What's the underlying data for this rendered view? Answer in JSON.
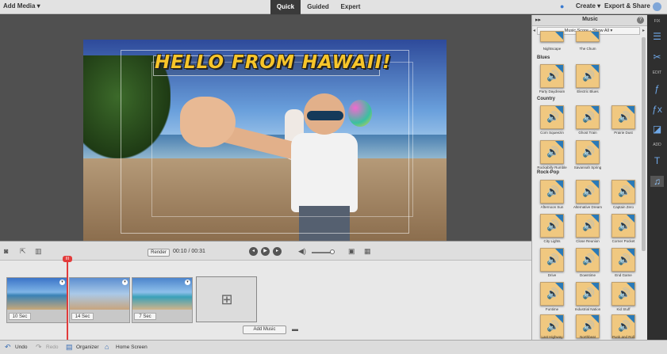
{
  "topbar": {
    "add_media": "Add Media ▾",
    "modes": [
      "Quick",
      "Guided",
      "Expert"
    ],
    "create": "Create ▾",
    "export_share": "Export & Share"
  },
  "viewer": {
    "title_text": "HELLO FROM HAWAII!"
  },
  "panel": {
    "title": "Music",
    "selector": "Music Score - Show All ▾",
    "categories": [
      {
        "name": "Blues",
        "items": [
          "Party Daydream",
          "Electric Blues"
        ]
      },
      {
        "name": "Country",
        "items": [
          "Corn Squeezin",
          "Ghost Train",
          "Prairie Dust",
          "Rockabilly Rumble",
          "Savannah Spring"
        ]
      },
      {
        "name": "Rock-Pop",
        "items": [
          "Afternoon Sun",
          "Alternative Dream",
          "Captain Zero",
          "City Lights",
          "Close Reunion",
          "Corner Pocket",
          "Drive",
          "Downtime",
          "End Game",
          "Funtime",
          "Industrial Nation",
          "Kid Stuff",
          "Last Highway",
          "Northbeat",
          "Punk and Roll"
        ]
      }
    ],
    "top_items": [
      "Nightscape",
      "The Chum"
    ]
  },
  "strip": {
    "fix_label": "FIX",
    "edit_label": "EDIT",
    "add_label": "ADD"
  },
  "timeline": {
    "render": "Render",
    "timecode": "00:10 / 00:31",
    "playhead": "III",
    "clips": [
      {
        "duration": "10 Sec"
      },
      {
        "duration": "14 Sec"
      },
      {
        "duration": "7 Sec"
      }
    ],
    "add_music": "Add Music"
  },
  "bottombar": {
    "undo": "Undo",
    "redo": "Redo",
    "organizer": "Organizer",
    "home_screen": "Home Screen"
  }
}
